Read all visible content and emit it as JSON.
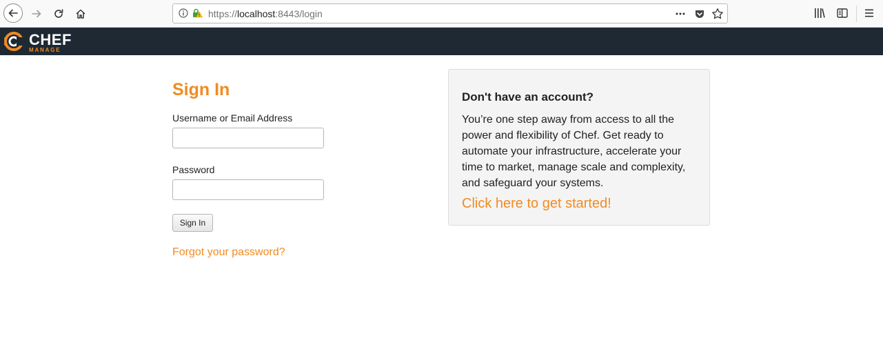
{
  "browser": {
    "url_prefix": "https://",
    "url_host": "localhost",
    "url_path": ":8443/login",
    "icons": [
      "back-icon",
      "forward-icon",
      "reload-icon",
      "home-icon",
      "info-icon",
      "insecure-lock-icon",
      "more-icon",
      "pocket-icon",
      "star-icon",
      "library-icon",
      "sidebar-icon",
      "menu-icon"
    ]
  },
  "app": {
    "logo_title": "CHEF",
    "logo_subtitle": "MANAGE"
  },
  "signin": {
    "title": "Sign In",
    "username_label": "Username or Email Address",
    "username_value": "",
    "password_label": "Password",
    "password_value": "",
    "submit_label": "Sign In",
    "forgot_link": "Forgot your password?"
  },
  "account_panel": {
    "heading": "Don't have an account?",
    "text": "You’re one step away from access to all the power and flexibility of Chef. Get ready to automate your infrastructure, accelerate your time to market, manage scale and complexity, and safeguard your systems.",
    "cta_link": "Click here to get started!"
  },
  "colors": {
    "accent": "#f18b21",
    "header_bg": "#1e2933",
    "panel_bg": "#f4f4f4"
  }
}
